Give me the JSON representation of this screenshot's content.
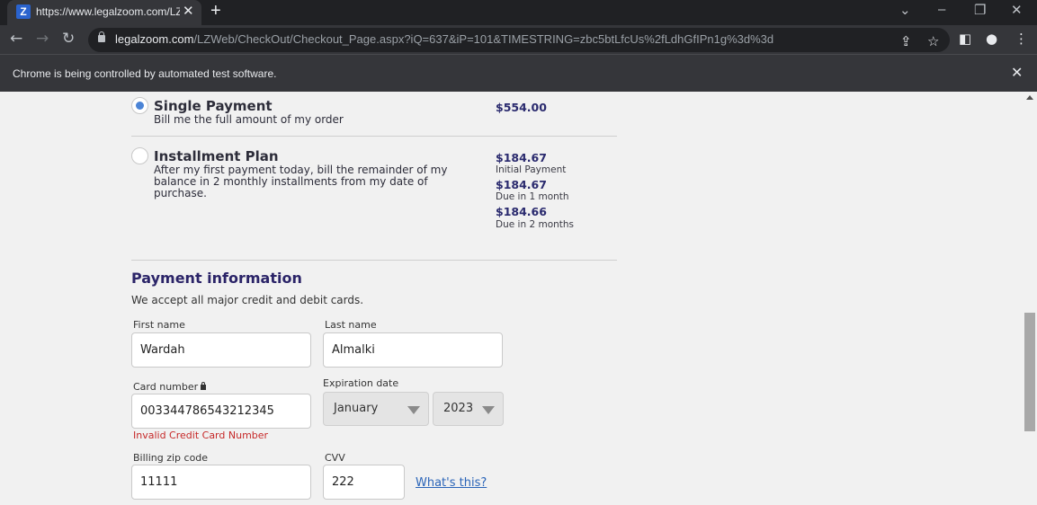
{
  "browser": {
    "tab_title": "https://www.legalzoom.com/LZW",
    "tab_favicon": "Z",
    "url_host": "legalzoom.com",
    "url_path": "/LZWeb/CheckOut/Checkout_Page.aspx?iQ=637&iP=101&TIMESTRING=zbc5btLfcUs%2fLdhGfIPn1g%3d%3d",
    "infobar_text": "Chrome is being controlled by automated test software."
  },
  "payment_options": {
    "single": {
      "title": "Single Payment",
      "description": "Bill me the full amount of my order",
      "price": "$554.00"
    },
    "installment": {
      "title": "Installment Plan",
      "description_lines": [
        "After my first payment today, bill the remainder of my",
        "balance in 2 monthly installments from my date of",
        "purchase."
      ],
      "prices": [
        {
          "amount": "$184.67",
          "note": "Initial Payment"
        },
        {
          "amount": "$184.67",
          "note": "Due in 1 month"
        },
        {
          "amount": "$184.66",
          "note": "Due in 2 months"
        }
      ]
    }
  },
  "payment_info": {
    "title": "Payment information",
    "subtitle": "We accept all major credit and debit cards.",
    "first_name_label": "First name",
    "first_name": "Wardah",
    "last_name_label": "Last name",
    "last_name": "Almalki",
    "card_number_label": "Card number",
    "card_number": "003344786543212345",
    "card_error": "Invalid Credit Card Number",
    "expiration_label": "Expiration date",
    "exp_month": "January",
    "exp_year": "2023",
    "zip_label": "Billing zip code",
    "zip": "11111",
    "cvv_label": "CVV",
    "cvv": "222",
    "whats_this": "What's this?"
  }
}
